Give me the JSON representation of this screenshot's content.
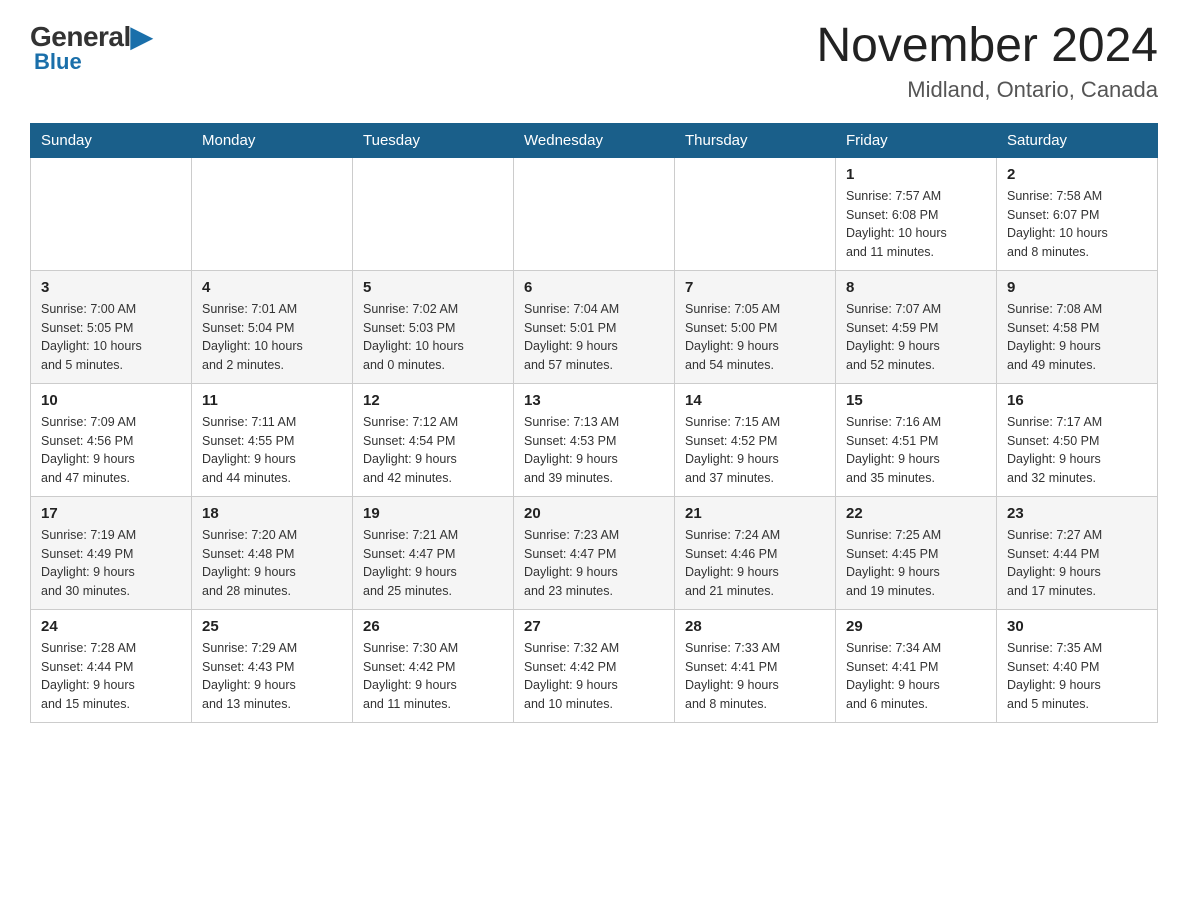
{
  "header": {
    "logo_top": "General",
    "logo_bottom": "Blue",
    "month_year": "November 2024",
    "location": "Midland, Ontario, Canada"
  },
  "days_of_week": [
    "Sunday",
    "Monday",
    "Tuesday",
    "Wednesday",
    "Thursday",
    "Friday",
    "Saturday"
  ],
  "weeks": [
    [
      {
        "day": "",
        "info": ""
      },
      {
        "day": "",
        "info": ""
      },
      {
        "day": "",
        "info": ""
      },
      {
        "day": "",
        "info": ""
      },
      {
        "day": "",
        "info": ""
      },
      {
        "day": "1",
        "info": "Sunrise: 7:57 AM\nSunset: 6:08 PM\nDaylight: 10 hours\nand 11 minutes."
      },
      {
        "day": "2",
        "info": "Sunrise: 7:58 AM\nSunset: 6:07 PM\nDaylight: 10 hours\nand 8 minutes."
      }
    ],
    [
      {
        "day": "3",
        "info": "Sunrise: 7:00 AM\nSunset: 5:05 PM\nDaylight: 10 hours\nand 5 minutes."
      },
      {
        "day": "4",
        "info": "Sunrise: 7:01 AM\nSunset: 5:04 PM\nDaylight: 10 hours\nand 2 minutes."
      },
      {
        "day": "5",
        "info": "Sunrise: 7:02 AM\nSunset: 5:03 PM\nDaylight: 10 hours\nand 0 minutes."
      },
      {
        "day": "6",
        "info": "Sunrise: 7:04 AM\nSunset: 5:01 PM\nDaylight: 9 hours\nand 57 minutes."
      },
      {
        "day": "7",
        "info": "Sunrise: 7:05 AM\nSunset: 5:00 PM\nDaylight: 9 hours\nand 54 minutes."
      },
      {
        "day": "8",
        "info": "Sunrise: 7:07 AM\nSunset: 4:59 PM\nDaylight: 9 hours\nand 52 minutes."
      },
      {
        "day": "9",
        "info": "Sunrise: 7:08 AM\nSunset: 4:58 PM\nDaylight: 9 hours\nand 49 minutes."
      }
    ],
    [
      {
        "day": "10",
        "info": "Sunrise: 7:09 AM\nSunset: 4:56 PM\nDaylight: 9 hours\nand 47 minutes."
      },
      {
        "day": "11",
        "info": "Sunrise: 7:11 AM\nSunset: 4:55 PM\nDaylight: 9 hours\nand 44 minutes."
      },
      {
        "day": "12",
        "info": "Sunrise: 7:12 AM\nSunset: 4:54 PM\nDaylight: 9 hours\nand 42 minutes."
      },
      {
        "day": "13",
        "info": "Sunrise: 7:13 AM\nSunset: 4:53 PM\nDaylight: 9 hours\nand 39 minutes."
      },
      {
        "day": "14",
        "info": "Sunrise: 7:15 AM\nSunset: 4:52 PM\nDaylight: 9 hours\nand 37 minutes."
      },
      {
        "day": "15",
        "info": "Sunrise: 7:16 AM\nSunset: 4:51 PM\nDaylight: 9 hours\nand 35 minutes."
      },
      {
        "day": "16",
        "info": "Sunrise: 7:17 AM\nSunset: 4:50 PM\nDaylight: 9 hours\nand 32 minutes."
      }
    ],
    [
      {
        "day": "17",
        "info": "Sunrise: 7:19 AM\nSunset: 4:49 PM\nDaylight: 9 hours\nand 30 minutes."
      },
      {
        "day": "18",
        "info": "Sunrise: 7:20 AM\nSunset: 4:48 PM\nDaylight: 9 hours\nand 28 minutes."
      },
      {
        "day": "19",
        "info": "Sunrise: 7:21 AM\nSunset: 4:47 PM\nDaylight: 9 hours\nand 25 minutes."
      },
      {
        "day": "20",
        "info": "Sunrise: 7:23 AM\nSunset: 4:47 PM\nDaylight: 9 hours\nand 23 minutes."
      },
      {
        "day": "21",
        "info": "Sunrise: 7:24 AM\nSunset: 4:46 PM\nDaylight: 9 hours\nand 21 minutes."
      },
      {
        "day": "22",
        "info": "Sunrise: 7:25 AM\nSunset: 4:45 PM\nDaylight: 9 hours\nand 19 minutes."
      },
      {
        "day": "23",
        "info": "Sunrise: 7:27 AM\nSunset: 4:44 PM\nDaylight: 9 hours\nand 17 minutes."
      }
    ],
    [
      {
        "day": "24",
        "info": "Sunrise: 7:28 AM\nSunset: 4:44 PM\nDaylight: 9 hours\nand 15 minutes."
      },
      {
        "day": "25",
        "info": "Sunrise: 7:29 AM\nSunset: 4:43 PM\nDaylight: 9 hours\nand 13 minutes."
      },
      {
        "day": "26",
        "info": "Sunrise: 7:30 AM\nSunset: 4:42 PM\nDaylight: 9 hours\nand 11 minutes."
      },
      {
        "day": "27",
        "info": "Sunrise: 7:32 AM\nSunset: 4:42 PM\nDaylight: 9 hours\nand 10 minutes."
      },
      {
        "day": "28",
        "info": "Sunrise: 7:33 AM\nSunset: 4:41 PM\nDaylight: 9 hours\nand 8 minutes."
      },
      {
        "day": "29",
        "info": "Sunrise: 7:34 AM\nSunset: 4:41 PM\nDaylight: 9 hours\nand 6 minutes."
      },
      {
        "day": "30",
        "info": "Sunrise: 7:35 AM\nSunset: 4:40 PM\nDaylight: 9 hours\nand 5 minutes."
      }
    ]
  ]
}
